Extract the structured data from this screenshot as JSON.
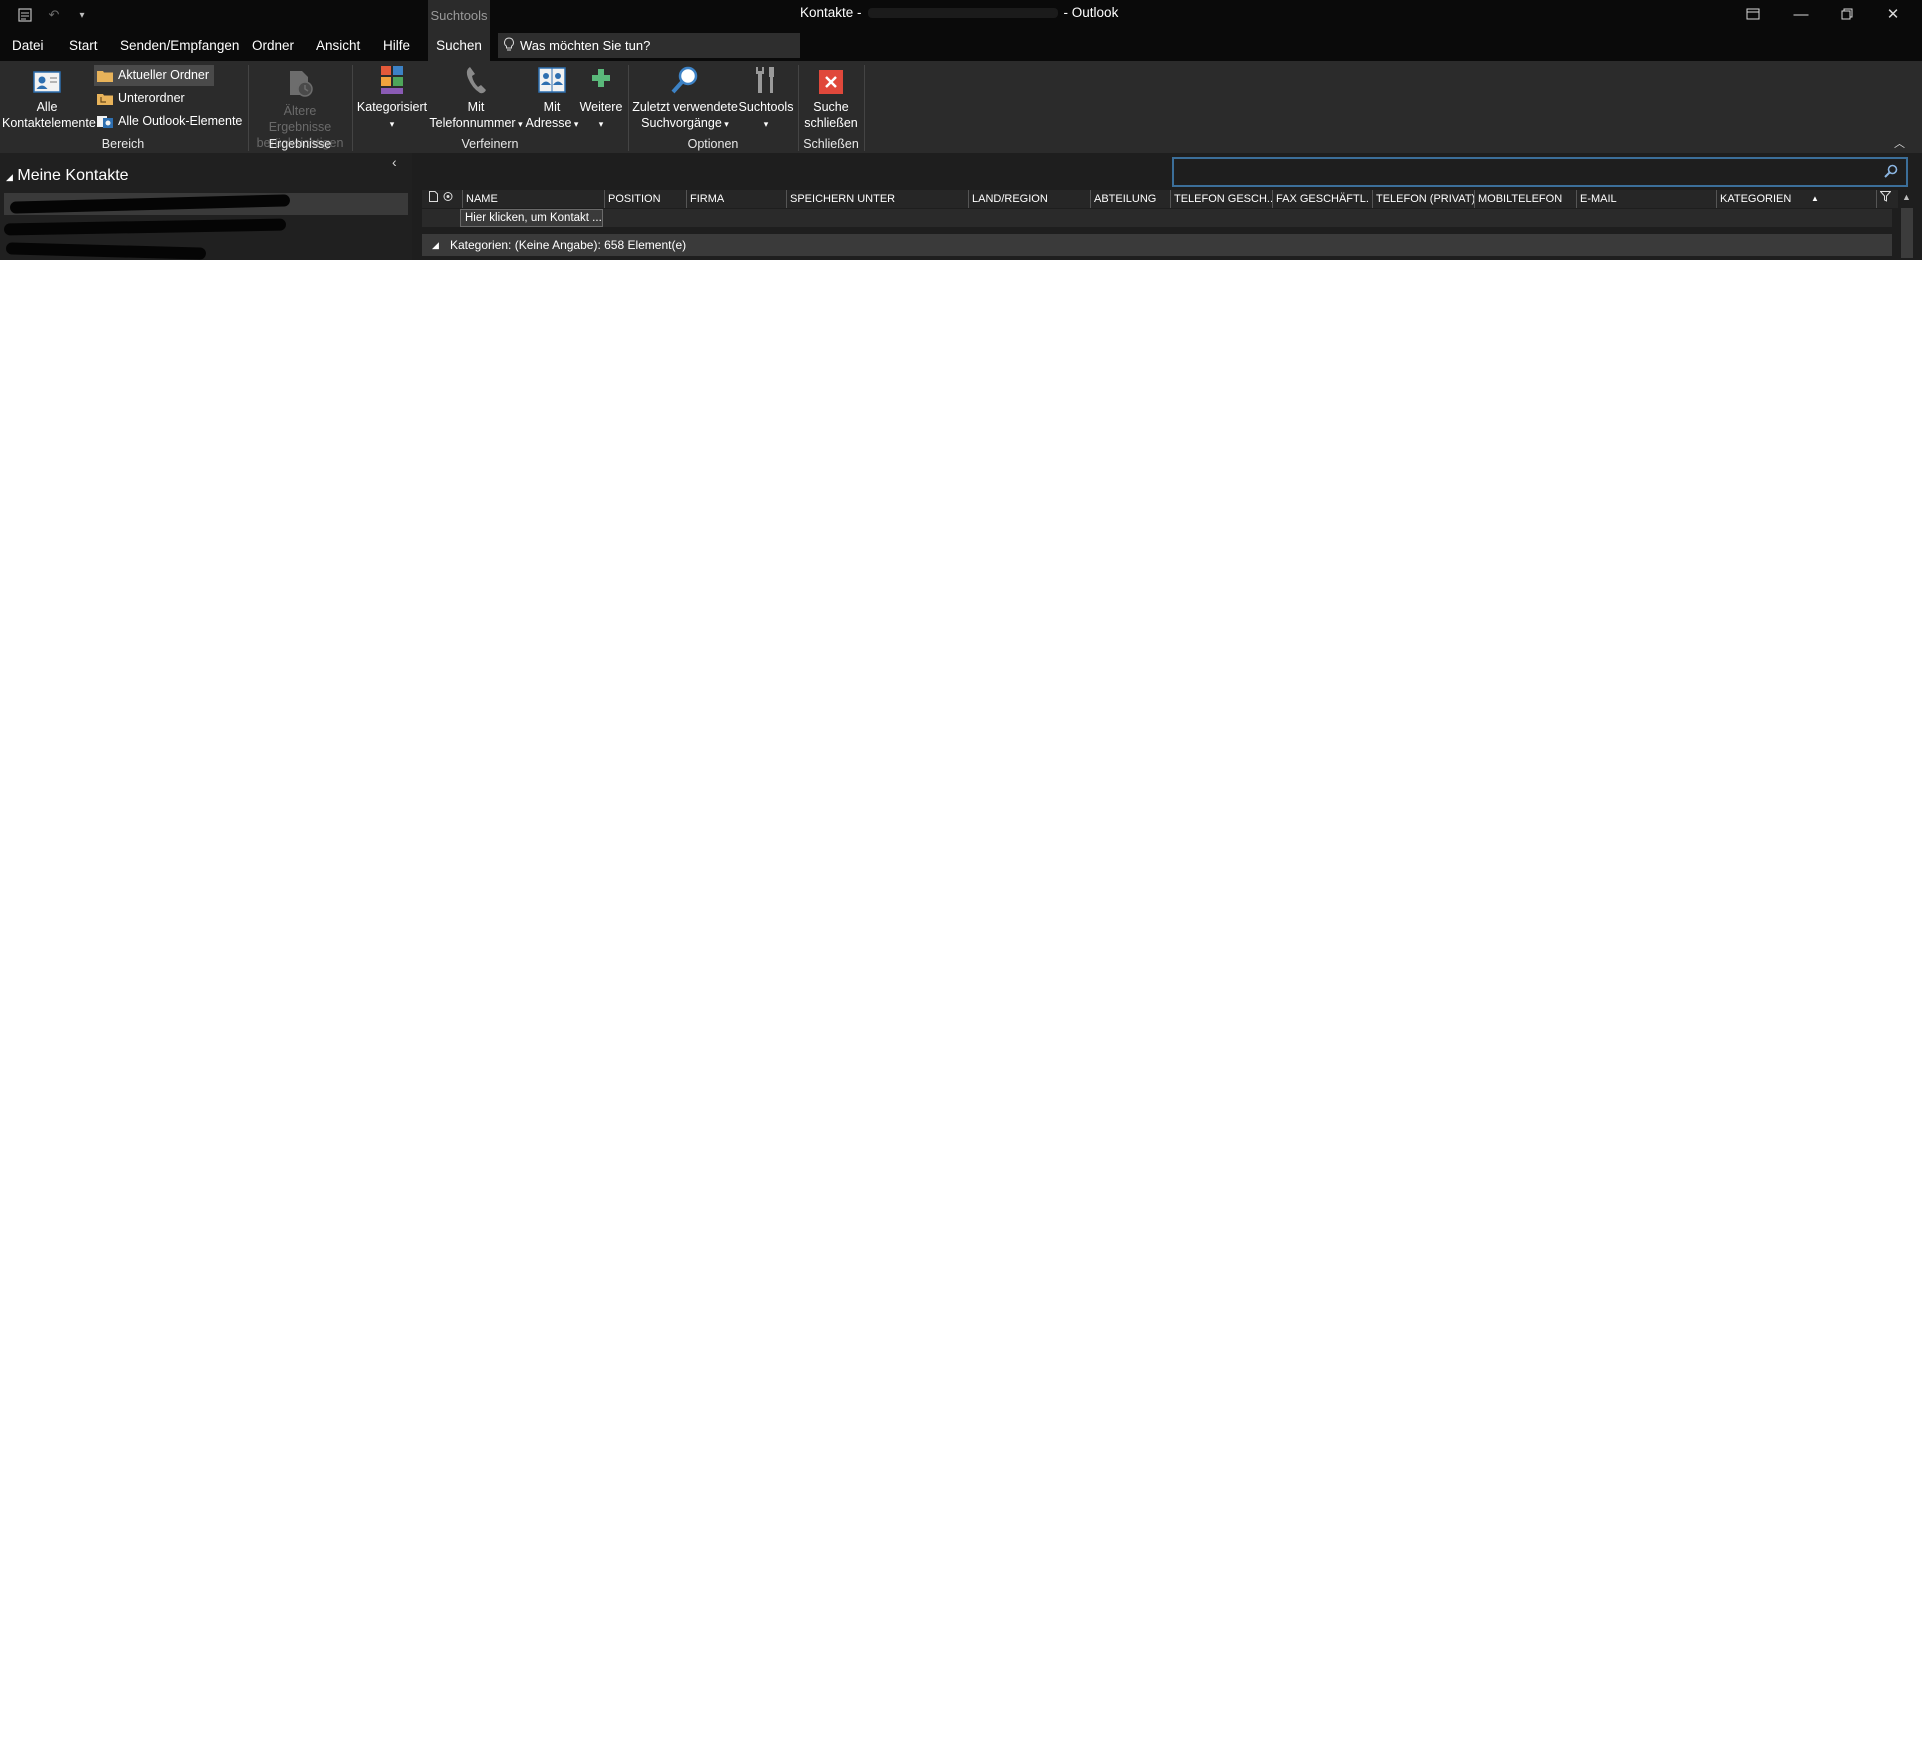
{
  "titlebar": {
    "context_tab": "Suchtools",
    "title_prefix": "Kontakte -",
    "title_suffix": "- Outlook"
  },
  "menu": {
    "tabs": [
      "Datei",
      "Start",
      "Senden/Empfangen",
      "Ordner",
      "Ansicht",
      "Hilfe",
      "Suchen"
    ],
    "active_tab": "Suchen",
    "tell_me": "Was möchten Sie tun?"
  },
  "ribbon": {
    "bereich": {
      "alle_kontaktelemente": [
        "Alle",
        "Kontaktelemente"
      ],
      "aktueller_ordner": "Aktueller Ordner",
      "unterordner": "Unterordner",
      "alle_outlook_elemente": "Alle Outlook-Elemente",
      "label": "Bereich"
    },
    "ergebnisse": {
      "aeltere": [
        "Ältere Ergebnisse",
        "berücksichtigen"
      ],
      "label": "Ergebnisse"
    },
    "verfeinern": {
      "kategorisiert": "Kategorisiert",
      "mit_telefonnummer": [
        "Mit",
        "Telefonnummer"
      ],
      "mit_adresse": [
        "Mit",
        "Adresse"
      ],
      "weitere": "Weitere",
      "label": "Verfeinern"
    },
    "optionen": {
      "zuletzt": [
        "Zuletzt verwendete",
        "Suchvorgänge"
      ],
      "suchtools": "Suchtools",
      "label": "Optionen"
    },
    "schliessen": {
      "suche_schliessen": [
        "Suche",
        "schließen"
      ],
      "label": "Schließen"
    }
  },
  "nav": {
    "title": "Meine Kontakte"
  },
  "search": {
    "value": ""
  },
  "grid": {
    "columns": [
      "NAME",
      "POSITION",
      "FIRMA",
      "SPEICHERN UNTER",
      "LAND/REGION",
      "ABTEILUNG",
      "TELEFON GESCH...",
      "FAX GESCHÄFTL.",
      "TELEFON (PRIVAT)",
      "MOBILTELEFON",
      "E-MAIL",
      "KATEGORIEN"
    ],
    "new_row_placeholder": "Hier klicken, um Kontakt ...",
    "group_header": "Kategorien: (Keine Angabe): 658 Element(e)"
  },
  "colors": {
    "accent_red": "#e0483b",
    "search_border": "#3b6e99",
    "add_green": "#5ab87a"
  }
}
